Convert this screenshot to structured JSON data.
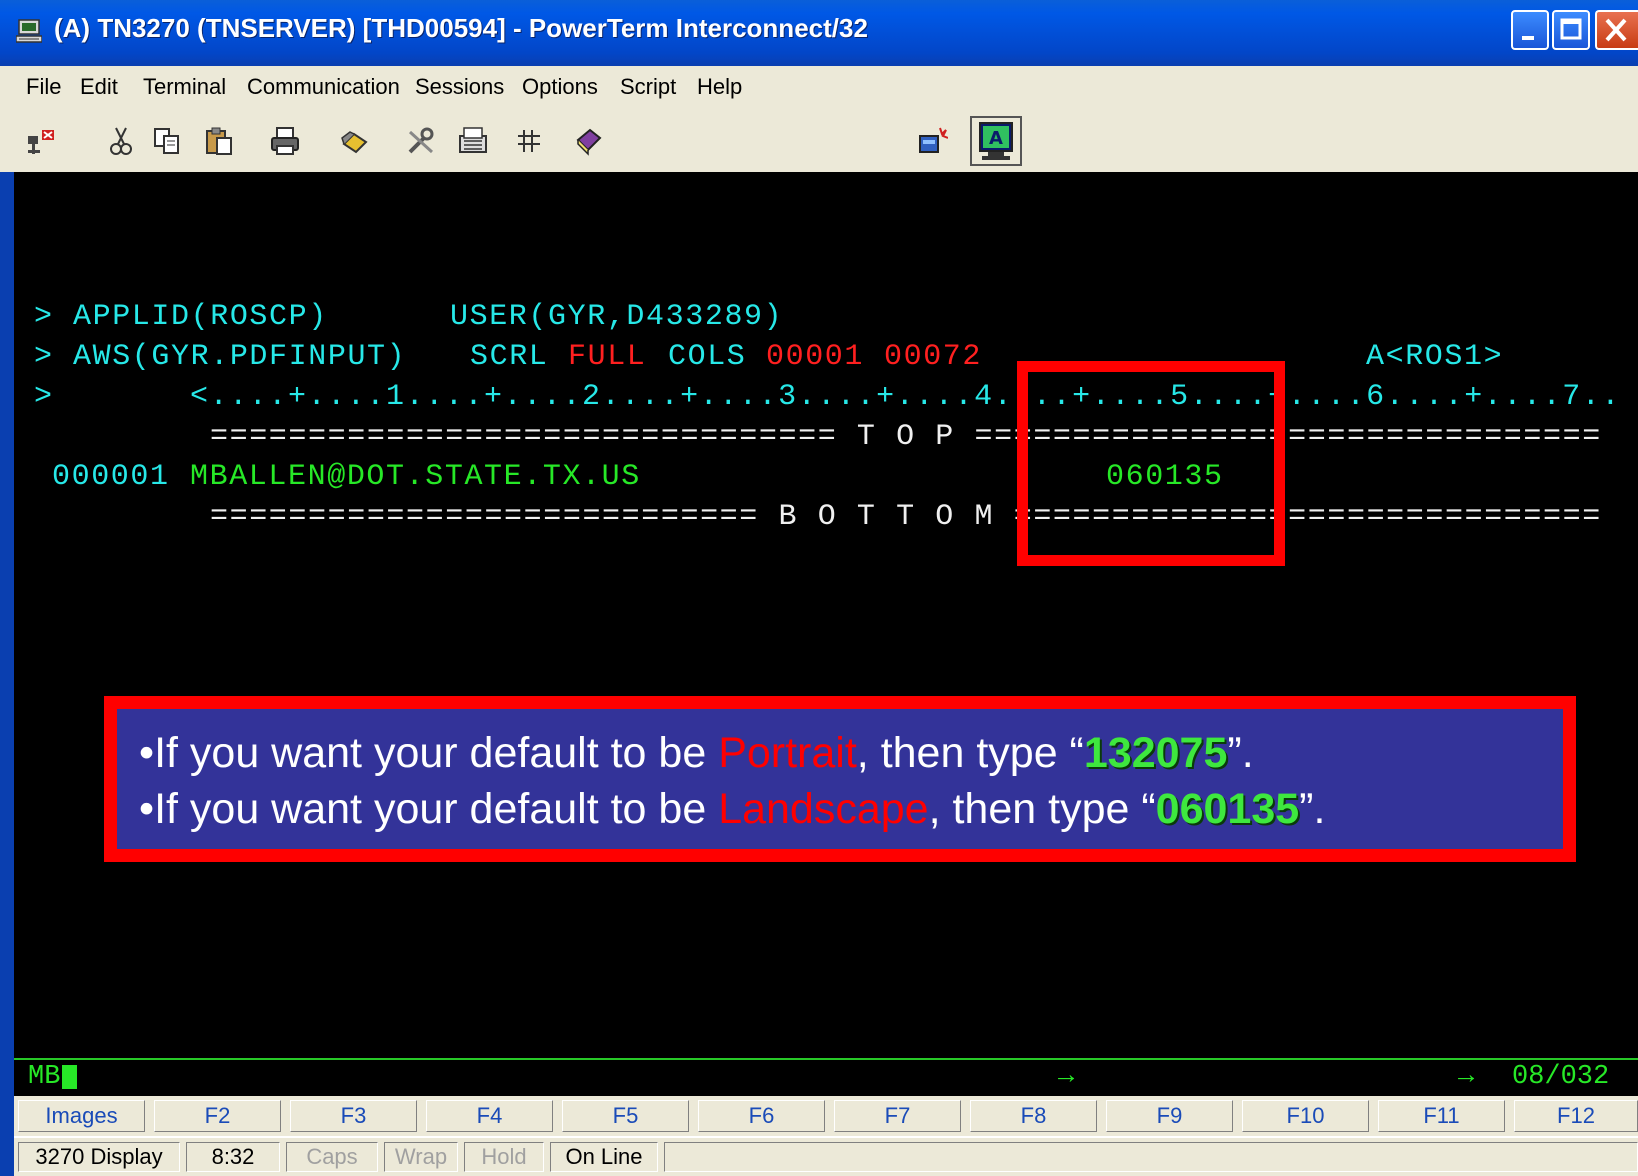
{
  "window": {
    "title": "(A) TN3270 (TNSERVER) [THD00594] - PowerTerm Interconnect/32"
  },
  "menu": [
    "File",
    "Edit",
    "Terminal",
    "Communication",
    "Sessions",
    "Options",
    "Script",
    "Help"
  ],
  "toolbar_icons": [
    "disconnect-icon",
    "cut-icon",
    "copy-icon",
    "paste-icon",
    "print-icon",
    "macro-icon",
    "settings-icon",
    "keyboard-icon",
    "grid-icon",
    "book-icon",
    "capture-icon",
    "display-a-icon"
  ],
  "terminal": {
    "line1": {
      "prompt": ">",
      "applid": "APPLID(ROSCP)",
      "user": "USER(GYR,D433289)"
    },
    "line2": {
      "prompt": ">",
      "aws": "AWS(GYR.PDFINPUT)",
      "scrl": "SCRL",
      "full": "FULL",
      "cols": "COLS",
      "col_from": "00001",
      "col_to": "00072",
      "ros": "A<ROS1>"
    },
    "ruler": {
      "prompt": ">",
      "text": "<....+....1....+....2....+....3....+....4....+....5....+....6....+....7.."
    },
    "top_line": "================================ T O P ================================",
    "data_row": {
      "number": "000001",
      "email": "MBALLEN@DOT.STATE.TX.US",
      "code": "060135"
    },
    "bottom_line": "============================ B O T T O M =============================="
  },
  "callout": {
    "line1": {
      "bullet": "•",
      "prefix": "If you want your default to be ",
      "mode": "Portrait",
      "middle": ", then type “",
      "code": "132075",
      "suffix": "”."
    },
    "line2": {
      "bullet": "•",
      "prefix": "If you want your default to be ",
      "mode": "Landscape",
      "middle": ", then type “",
      "code": "060135",
      "suffix": "”."
    }
  },
  "oia": {
    "left": "MB",
    "arrow1": "→",
    "arrow2": "→",
    "position": "08/032"
  },
  "function_keys": [
    "Images",
    "F2",
    "F3",
    "F4",
    "F5",
    "F6",
    "F7",
    "F8",
    "F9",
    "F10",
    "F11",
    "F12"
  ],
  "status": {
    "display": "3270 Display",
    "time": "8:32",
    "caps": "Caps",
    "wrap": "Wrap",
    "hold": "Hold",
    "online": "On Line"
  },
  "colors": {
    "title_blue": "#0058e6",
    "terminal_green": "#27e827",
    "terminal_cyan": "#27e8e8",
    "terminal_red": "#ff2020",
    "highlight_red": "#ff0000",
    "callout_bg": "#333399"
  }
}
